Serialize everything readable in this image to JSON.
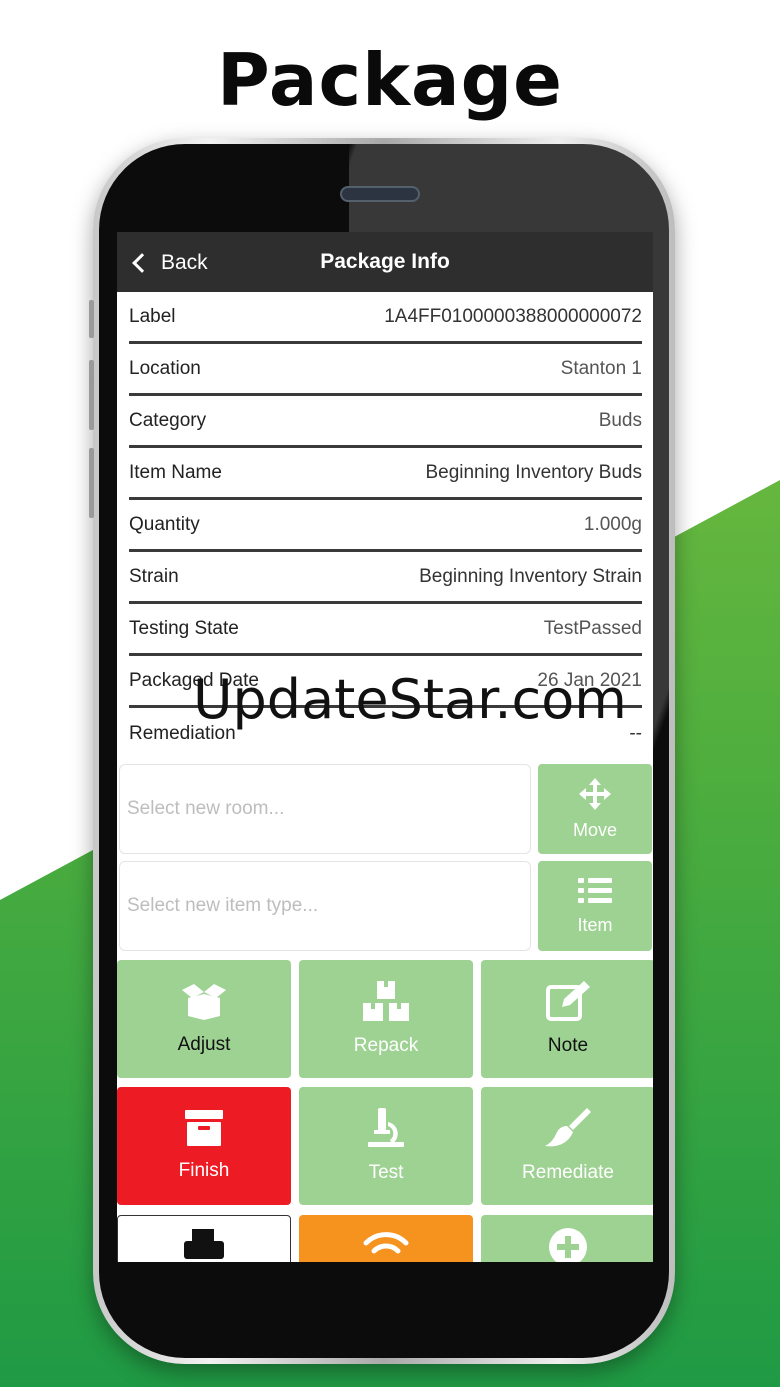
{
  "promo": {
    "title": "Package"
  },
  "navbar": {
    "back_label": "Back",
    "title": "Package Info"
  },
  "info_rows": [
    {
      "label": "Label",
      "value": "1A4FF0100000388000000072"
    },
    {
      "label": "Location",
      "value": "Stanton 1"
    },
    {
      "label": "Category",
      "value": "Buds"
    },
    {
      "label": "Item Name",
      "value": "Beginning Inventory Buds"
    },
    {
      "label": "Quantity",
      "value": "1.000g"
    },
    {
      "label": "Strain",
      "value": "Beginning Inventory Strain"
    },
    {
      "label": "Testing State",
      "value": "TestPassed"
    },
    {
      "label": "Packaged Date",
      "value": "26 Jan 2021"
    },
    {
      "label": "Remediation",
      "value": "--"
    }
  ],
  "watermark": "UpdateStar.com",
  "move": {
    "placeholder": "Select new room...",
    "button_label": "Move",
    "icon": "move-arrows-icon"
  },
  "item": {
    "placeholder": "Select new item type...",
    "button_label": "Item",
    "icon": "list-icon"
  },
  "actions": [
    {
      "label": "Adjust",
      "icon": "open-box-icon"
    },
    {
      "label": "Repack",
      "icon": "boxes-icon"
    },
    {
      "label": "Note",
      "icon": "edit-icon"
    },
    {
      "label": "Finish",
      "icon": "archive-icon"
    },
    {
      "label": "Test",
      "icon": "microscope-icon"
    },
    {
      "label": "Remediate",
      "icon": "brush-icon"
    },
    {
      "label": "",
      "icon": "printer-icon"
    },
    {
      "label": "",
      "icon": "wifi-icon"
    },
    {
      "label": "",
      "icon": "plus-circle-icon"
    }
  ],
  "colors": {
    "accent_green": "#9ed292",
    "finish_red": "#ed1c24",
    "orange": "#f6921e",
    "navbar": "#2e2e2e"
  }
}
